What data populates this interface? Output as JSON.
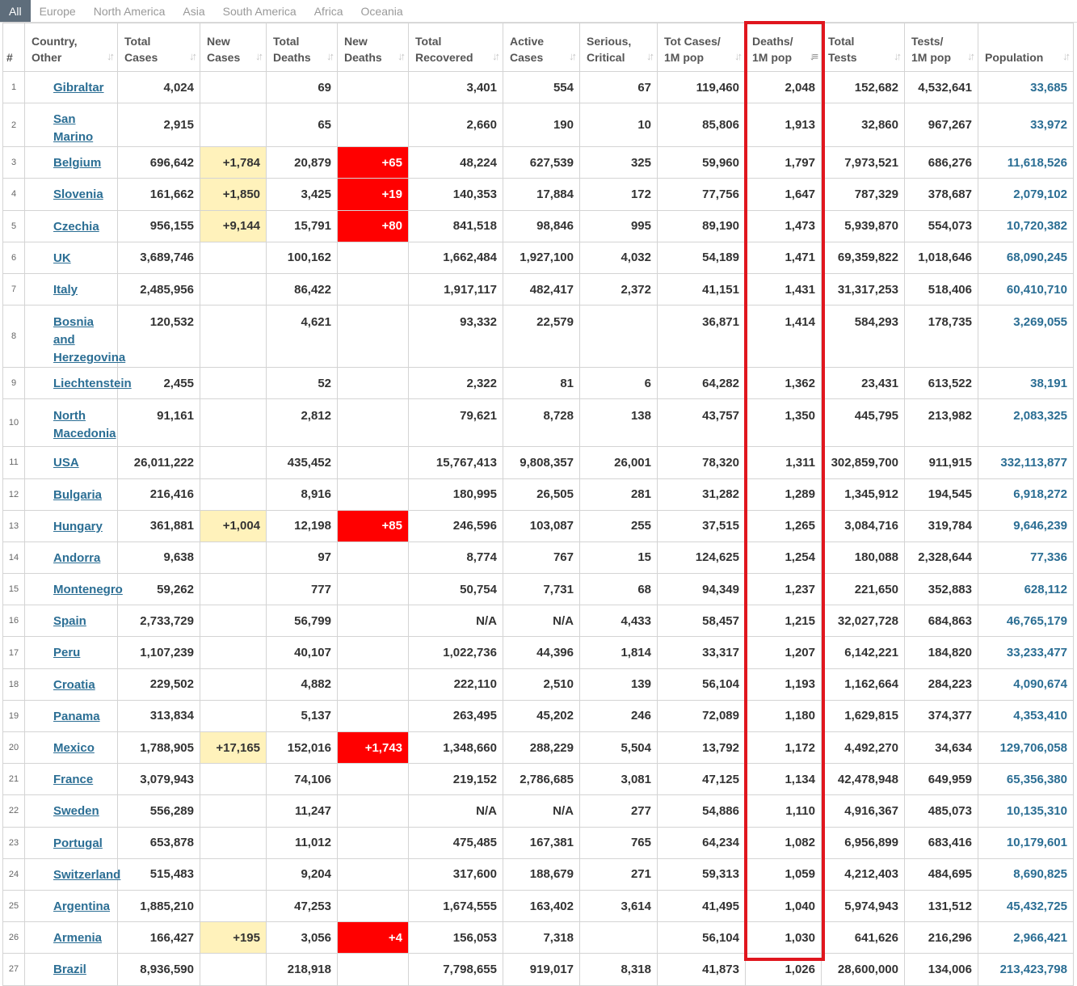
{
  "tabs": [
    {
      "label": "All",
      "active": true
    },
    {
      "label": "Europe",
      "active": false
    },
    {
      "label": "North America",
      "active": false
    },
    {
      "label": "Asia",
      "active": false
    },
    {
      "label": "South America",
      "active": false
    },
    {
      "label": "Africa",
      "active": false
    },
    {
      "label": "Oceania",
      "active": false
    }
  ],
  "columns": [
    {
      "label": "#",
      "key": "idx"
    },
    {
      "label": "Country,\nOther",
      "key": "country"
    },
    {
      "label": "Total\nCases",
      "key": "total_cases"
    },
    {
      "label": "New\nCases",
      "key": "new_cases"
    },
    {
      "label": "Total\nDeaths",
      "key": "total_deaths"
    },
    {
      "label": "New\nDeaths",
      "key": "new_deaths"
    },
    {
      "label": "Total\nRecovered",
      "key": "total_recovered"
    },
    {
      "label": "Active\nCases",
      "key": "active_cases"
    },
    {
      "label": "Serious,\nCritical",
      "key": "serious"
    },
    {
      "label": "Tot Cases/\n1M pop",
      "key": "cases_per_m"
    },
    {
      "label": "Deaths/\n1M pop",
      "key": "deaths_per_m",
      "sorted": true
    },
    {
      "label": "Total\nTests",
      "key": "total_tests"
    },
    {
      "label": "Tests/\n1M pop",
      "key": "tests_per_m"
    },
    {
      "label": "Population",
      "key": "population"
    }
  ],
  "rows": [
    [
      "1",
      "Gibraltar",
      "4,024",
      "",
      "69",
      "",
      "3,401",
      "554",
      "67",
      "119,460",
      "2,048",
      "152,682",
      "4,532,641",
      "33,685"
    ],
    [
      "2",
      "San Marino",
      "2,915",
      "",
      "65",
      "",
      "2,660",
      "190",
      "10",
      "85,806",
      "1,913",
      "32,860",
      "967,267",
      "33,972"
    ],
    [
      "3",
      "Belgium",
      "696,642",
      "+1,784",
      "20,879",
      "+65",
      "48,224",
      "627,539",
      "325",
      "59,960",
      "1,797",
      "7,973,521",
      "686,276",
      "11,618,526"
    ],
    [
      "4",
      "Slovenia",
      "161,662",
      "+1,850",
      "3,425",
      "+19",
      "140,353",
      "17,884",
      "172",
      "77,756",
      "1,647",
      "787,329",
      "378,687",
      "2,079,102"
    ],
    [
      "5",
      "Czechia",
      "956,155",
      "+9,144",
      "15,791",
      "+80",
      "841,518",
      "98,846",
      "995",
      "89,190",
      "1,473",
      "5,939,870",
      "554,073",
      "10,720,382"
    ],
    [
      "6",
      "UK",
      "3,689,746",
      "",
      "100,162",
      "",
      "1,662,484",
      "1,927,100",
      "4,032",
      "54,189",
      "1,471",
      "69,359,822",
      "1,018,646",
      "68,090,245"
    ],
    [
      "7",
      "Italy",
      "2,485,956",
      "",
      "86,422",
      "",
      "1,917,117",
      "482,417",
      "2,372",
      "41,151",
      "1,431",
      "31,317,253",
      "518,406",
      "60,410,710"
    ],
    [
      "8",
      "Bosnia and Herzegovina",
      "120,532",
      "",
      "4,621",
      "",
      "93,332",
      "22,579",
      "",
      "36,871",
      "1,414",
      "584,293",
      "178,735",
      "3,269,055"
    ],
    [
      "9",
      "Liechtenstein",
      "2,455",
      "",
      "52",
      "",
      "2,322",
      "81",
      "6",
      "64,282",
      "1,362",
      "23,431",
      "613,522",
      "38,191"
    ],
    [
      "10",
      "North Macedonia",
      "91,161",
      "",
      "2,812",
      "",
      "79,621",
      "8,728",
      "138",
      "43,757",
      "1,350",
      "445,795",
      "213,982",
      "2,083,325"
    ],
    [
      "11",
      "USA",
      "26,011,222",
      "",
      "435,452",
      "",
      "15,767,413",
      "9,808,357",
      "26,001",
      "78,320",
      "1,311",
      "302,859,700",
      "911,915",
      "332,113,877"
    ],
    [
      "12",
      "Bulgaria",
      "216,416",
      "",
      "8,916",
      "",
      "180,995",
      "26,505",
      "281",
      "31,282",
      "1,289",
      "1,345,912",
      "194,545",
      "6,918,272"
    ],
    [
      "13",
      "Hungary",
      "361,881",
      "+1,004",
      "12,198",
      "+85",
      "246,596",
      "103,087",
      "255",
      "37,515",
      "1,265",
      "3,084,716",
      "319,784",
      "9,646,239"
    ],
    [
      "14",
      "Andorra",
      "9,638",
      "",
      "97",
      "",
      "8,774",
      "767",
      "15",
      "124,625",
      "1,254",
      "180,088",
      "2,328,644",
      "77,336"
    ],
    [
      "15",
      "Montenegro",
      "59,262",
      "",
      "777",
      "",
      "50,754",
      "7,731",
      "68",
      "94,349",
      "1,237",
      "221,650",
      "352,883",
      "628,112"
    ],
    [
      "16",
      "Spain",
      "2,733,729",
      "",
      "56,799",
      "",
      "N/A",
      "N/A",
      "4,433",
      "58,457",
      "1,215",
      "32,027,728",
      "684,863",
      "46,765,179"
    ],
    [
      "17",
      "Peru",
      "1,107,239",
      "",
      "40,107",
      "",
      "1,022,736",
      "44,396",
      "1,814",
      "33,317",
      "1,207",
      "6,142,221",
      "184,820",
      "33,233,477"
    ],
    [
      "18",
      "Croatia",
      "229,502",
      "",
      "4,882",
      "",
      "222,110",
      "2,510",
      "139",
      "56,104",
      "1,193",
      "1,162,664",
      "284,223",
      "4,090,674"
    ],
    [
      "19",
      "Panama",
      "313,834",
      "",
      "5,137",
      "",
      "263,495",
      "45,202",
      "246",
      "72,089",
      "1,180",
      "1,629,815",
      "374,377",
      "4,353,410"
    ],
    [
      "20",
      "Mexico",
      "1,788,905",
      "+17,165",
      "152,016",
      "+1,743",
      "1,348,660",
      "288,229",
      "5,504",
      "13,792",
      "1,172",
      "4,492,270",
      "34,634",
      "129,706,058"
    ],
    [
      "21",
      "France",
      "3,079,943",
      "",
      "74,106",
      "",
      "219,152",
      "2,786,685",
      "3,081",
      "47,125",
      "1,134",
      "42,478,948",
      "649,959",
      "65,356,380"
    ],
    [
      "22",
      "Sweden",
      "556,289",
      "",
      "11,247",
      "",
      "N/A",
      "N/A",
      "277",
      "54,886",
      "1,110",
      "4,916,367",
      "485,073",
      "10,135,310"
    ],
    [
      "23",
      "Portugal",
      "653,878",
      "",
      "11,012",
      "",
      "475,485",
      "167,381",
      "765",
      "64,234",
      "1,082",
      "6,956,899",
      "683,416",
      "10,179,601"
    ],
    [
      "24",
      "Switzerland",
      "515,483",
      "",
      "9,204",
      "",
      "317,600",
      "188,679",
      "271",
      "59,313",
      "1,059",
      "4,212,403",
      "484,695",
      "8,690,825"
    ],
    [
      "25",
      "Argentina",
      "1,885,210",
      "",
      "47,253",
      "",
      "1,674,555",
      "163,402",
      "3,614",
      "41,495",
      "1,040",
      "5,974,943",
      "131,512",
      "45,432,725"
    ],
    [
      "26",
      "Armenia",
      "166,427",
      "+195",
      "3,056",
      "+4",
      "156,053",
      "7,318",
      "",
      "56,104",
      "1,030",
      "641,626",
      "216,296",
      "2,966,421"
    ],
    [
      "27",
      "Brazil",
      "8,936,590",
      "",
      "218,918",
      "",
      "7,798,655",
      "919,017",
      "8,318",
      "41,873",
      "1,026",
      "28,600,000",
      "134,006",
      "213,423,798"
    ]
  ],
  "colors": {
    "new_cases_bg": "#fff2bb",
    "new_deaths_bg": "#ff0000",
    "link": "#2b6e94",
    "highlight_border": "#e0161e",
    "active_tab_bg": "#5e6d7b"
  },
  "icons": {
    "sort": "sort-arrows-icon",
    "sort_active": "sort-descending-icon"
  }
}
